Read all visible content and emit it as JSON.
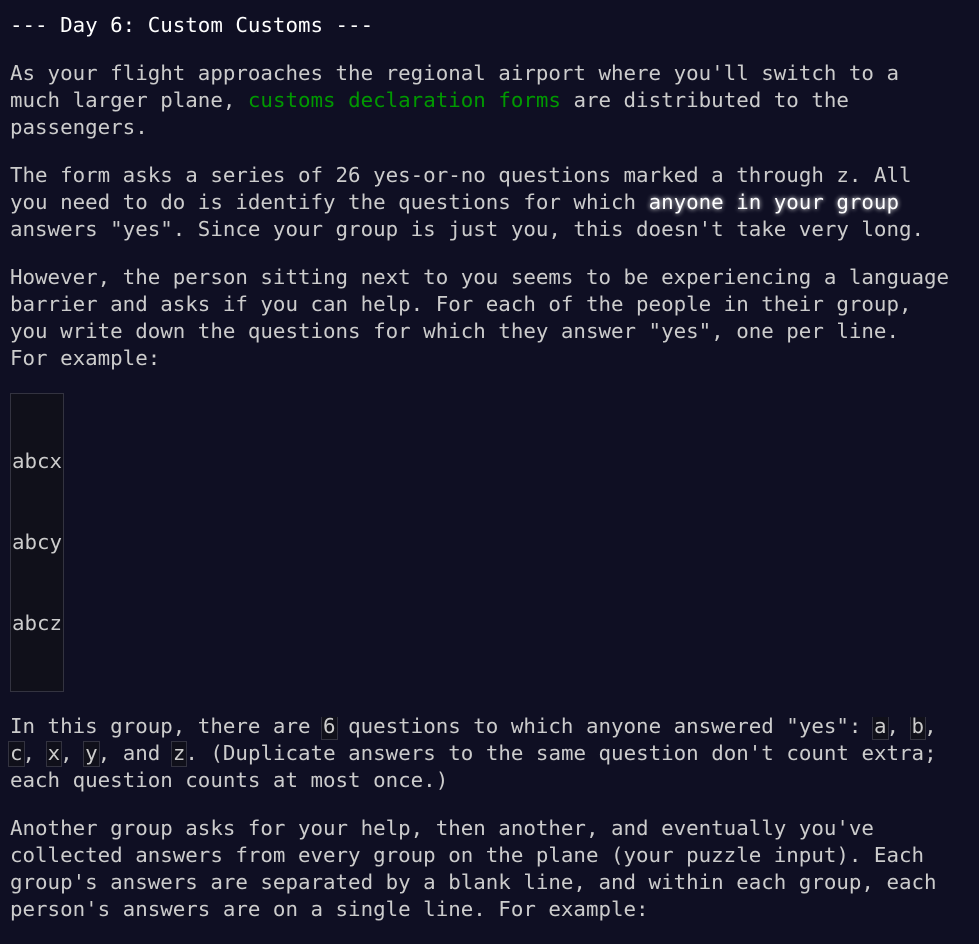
{
  "title": "--- Day 6: Custom Customs ---",
  "p1": {
    "a": "As your flight approaches the regional airport where you'll switch to a",
    "b_pre": "much larger plane, ",
    "b_link": "customs declaration forms",
    "b_post": " are distributed to the",
    "c": "passengers."
  },
  "p2": {
    "a_pre": "The form asks a series of 26 yes-or-no questions marked ",
    "a_code1": "a",
    "a_mid": " through ",
    "a_code2": "z",
    "a_post": ". All",
    "b_pre": "you need to do is identify the questions for which ",
    "b_em": "anyone in your group",
    "c": "answers \"yes\". Since your group is just you, this doesn't take very long."
  },
  "p3": {
    "a": "However, the person sitting next to you seems to be experiencing a language",
    "b": "barrier and asks if you can help. For each of the people in their group,",
    "c": "you write down the questions for which they answer \"yes\", one per line.",
    "d": "For example:"
  },
  "example1": [
    "abcx",
    "abcy",
    "abcz"
  ],
  "p4": {
    "a_pre": "In this group, there are ",
    "a_num": "6",
    "a_mid": " questions to which anyone answered \"yes\": ",
    "a_c1": "a",
    "a_sep1": ", ",
    "a_c2": "b",
    "a_post": ",",
    "b_c3": "c",
    "b_sep1": ", ",
    "b_c4": "x",
    "b_sep2": ", ",
    "b_c5": "y",
    "b_sep3": ", and ",
    "b_c6": "z",
    "b_post": ". (Duplicate answers to the same question don't count extra;",
    "c": "each question counts at most once.)"
  },
  "p5": {
    "a": "Another group asks for your help, then another, and eventually you've",
    "b": "collected answers from every group on the plane (your puzzle input). Each",
    "c": "group's answers are separated by a blank line, and within each group, each",
    "d": "person's answers are on a single line. For example:"
  }
}
